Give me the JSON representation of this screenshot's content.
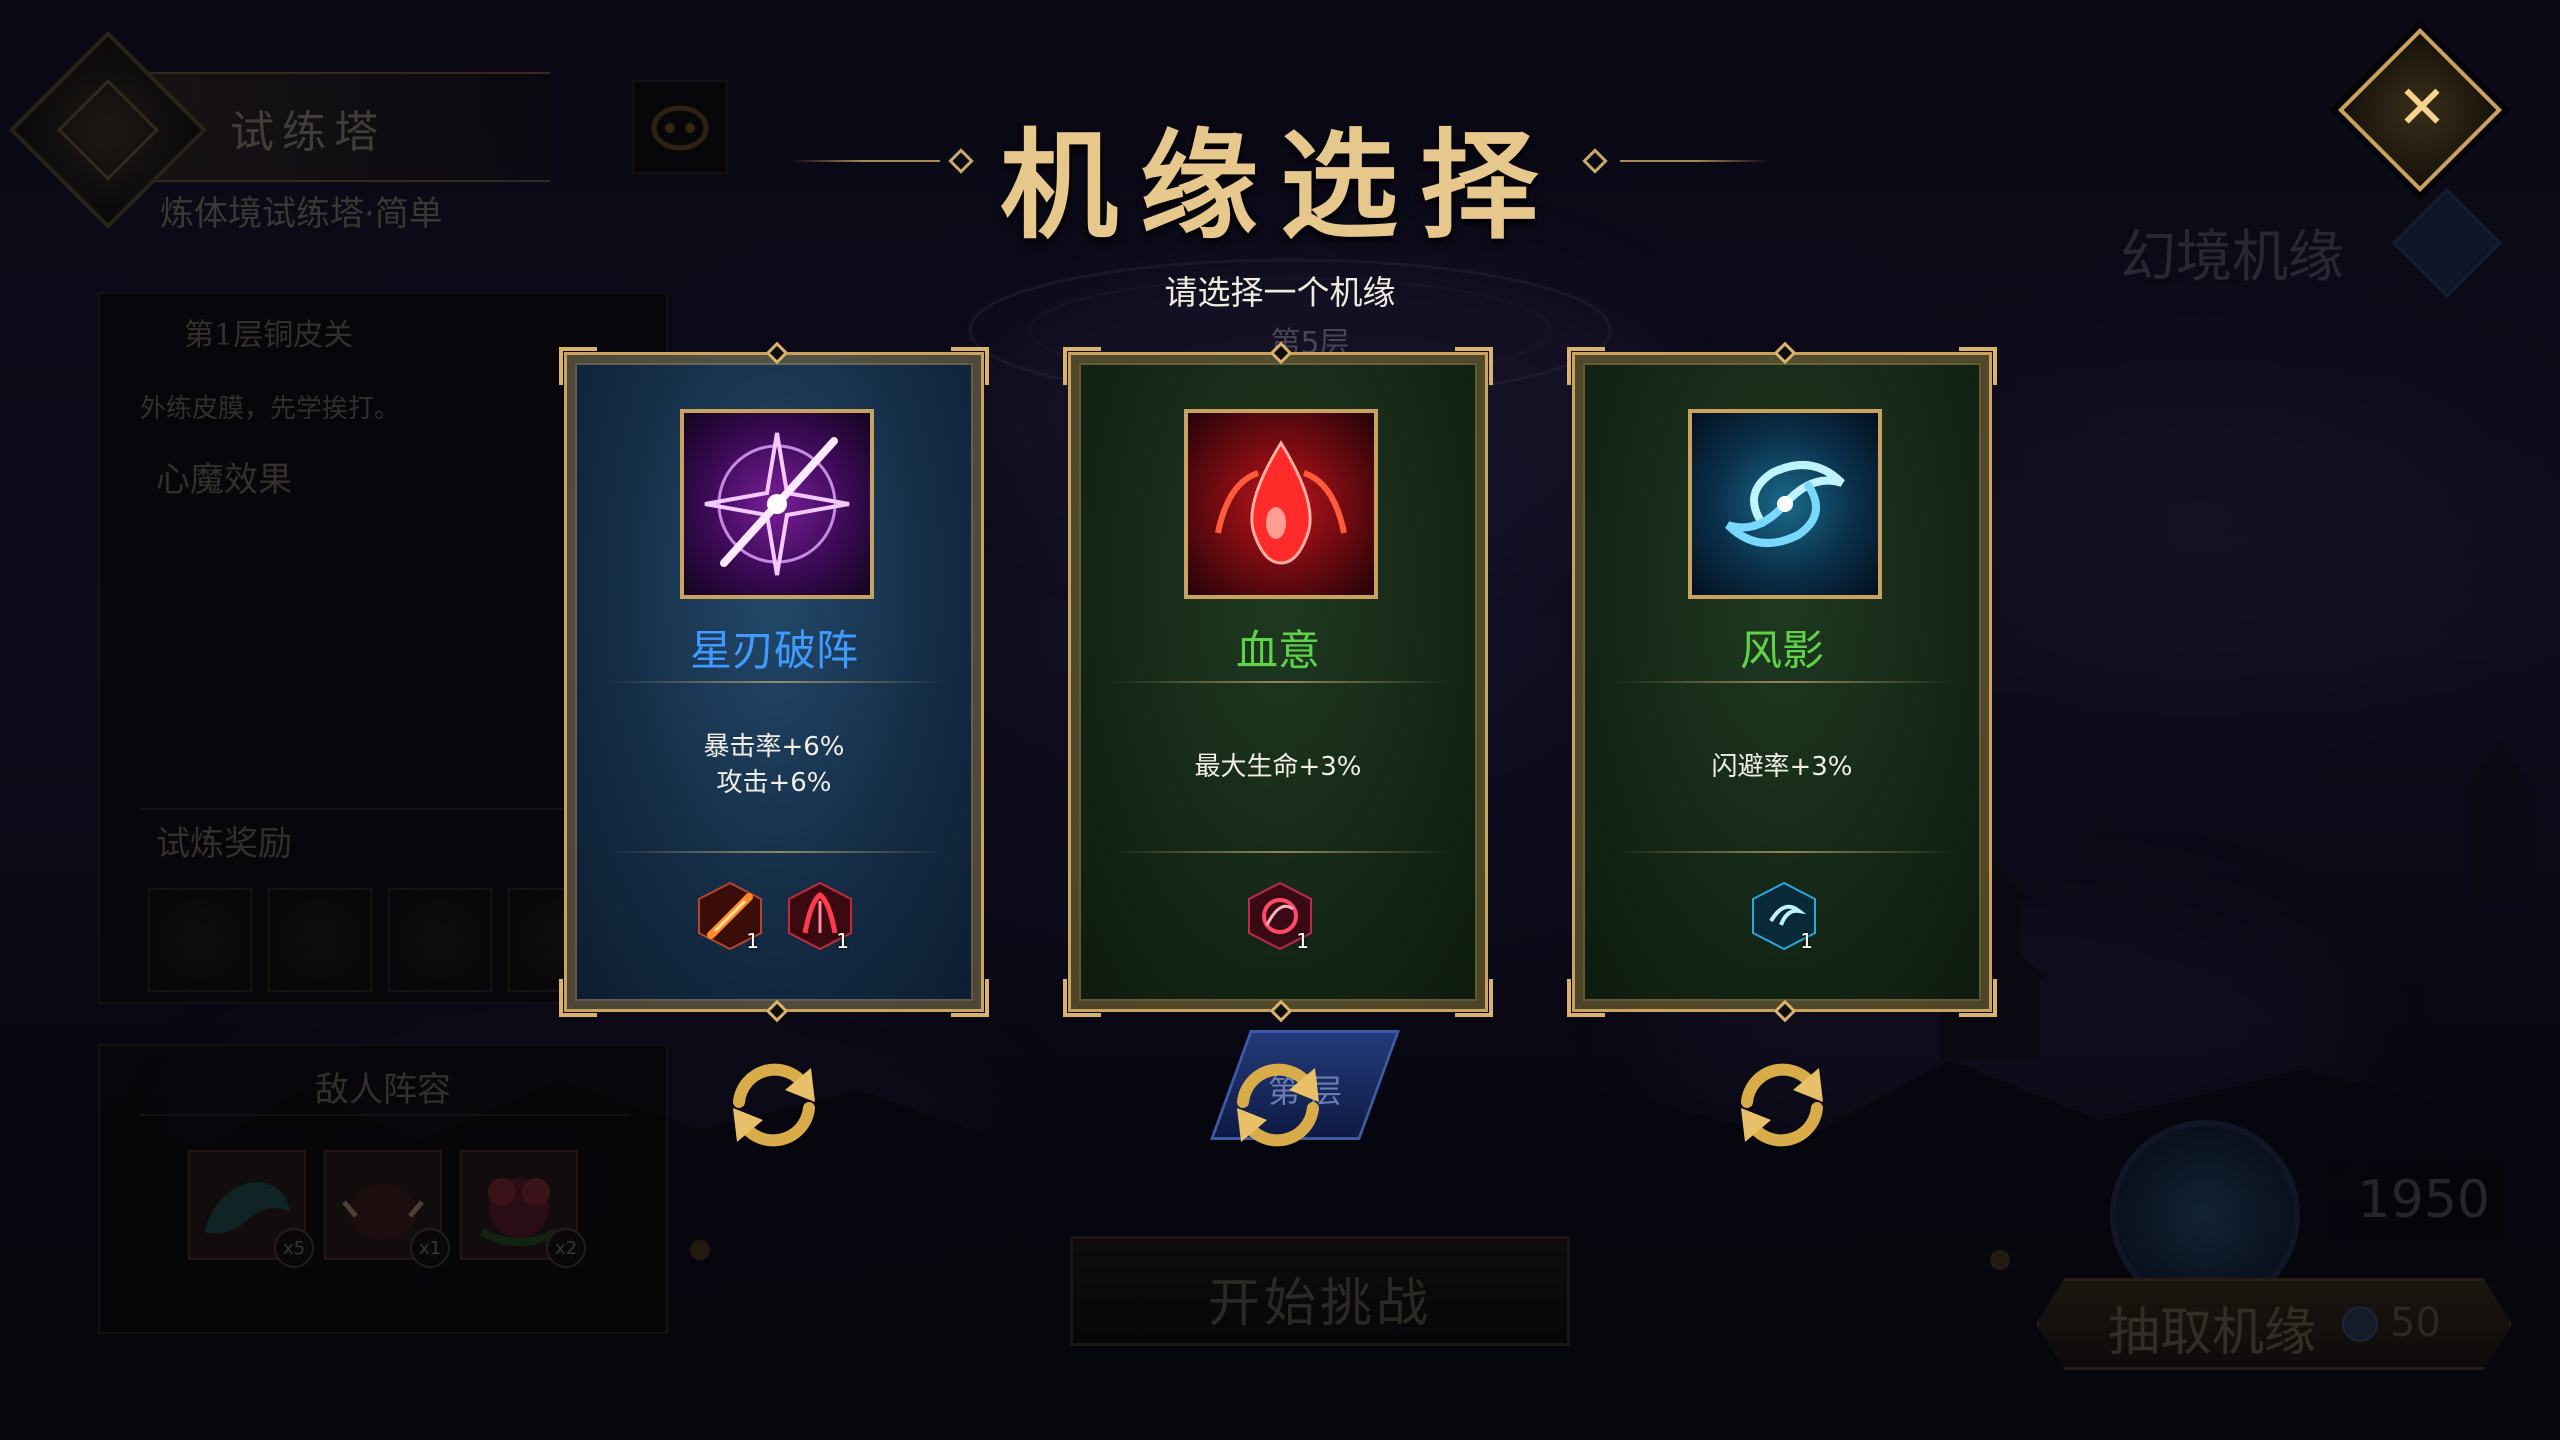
{
  "header": {
    "title": "机缘选择",
    "instruction": "请选择一个机缘"
  },
  "background": {
    "floor_label": "第5层",
    "floor_badge": "第 层"
  },
  "left_panel": {
    "tower_title": "试练塔",
    "tower_subtitle": "炼体境试练塔·简单",
    "stage_name": "第1层铜皮关",
    "stage_desc": "外练皮膜，先学挨打。",
    "heart_demon_label": "心魔效果",
    "reward_label": "试炼奖励",
    "enemy_label": "敌人阵容",
    "enemies": [
      {
        "icon": "dragon-icon",
        "count": "x5"
      },
      {
        "icon": "boar-icon",
        "count": "x1"
      },
      {
        "icon": "flower-monster-icon",
        "count": "x2"
      }
    ]
  },
  "cards": [
    {
      "name": "星刃破阵",
      "name_color": "#3f9bff",
      "theme": "blue",
      "icon": "star-blade-icon",
      "effects": [
        "暴击率+6%",
        "攻击+6%"
      ],
      "items": [
        {
          "icon": "fire-slash-icon",
          "count": "1"
        },
        {
          "icon": "blood-claw-icon",
          "count": "1"
        }
      ]
    },
    {
      "name": "血意",
      "name_color": "#5fd24a",
      "theme": "green",
      "icon": "blood-drop-icon",
      "effects": [
        "最大生命+3%"
      ],
      "items": [
        {
          "icon": "blood-orb-icon",
          "count": "1"
        }
      ]
    },
    {
      "name": "风影",
      "name_color": "#5fd24a",
      "theme": "green",
      "icon": "wind-vortex-icon",
      "effects": [
        "闪避率+3%"
      ],
      "items": [
        {
          "icon": "wind-gem-icon",
          "count": "1"
        }
      ]
    }
  ],
  "right_panel": {
    "illusion_label": "幻境机缘",
    "currency_amount": "1950",
    "draw_label": "抽取机缘",
    "draw_cost": "50"
  },
  "start_button": "开始挑战",
  "colors": {
    "gold": "#c9a260",
    "title_gold": "#e6c78c",
    "blue_name": "#3f9bff",
    "green_name": "#5fd24a"
  }
}
